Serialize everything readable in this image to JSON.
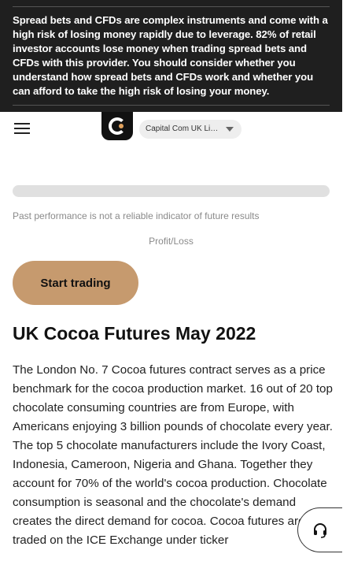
{
  "risk_warning": {
    "text_start": "Spread bets and CFDs are complex instruments and come with a high risk of losing money rapidly due to leverage. ",
    "text_bold": "82% of retail investor accounts lose money when trading spread bets and CFDs with this provider",
    "text_end": ". You should consider whether you understand how spread bets and CFDs work and whether you can afford to take the high risk of losing your money."
  },
  "header": {
    "entity_selector": "Capital Com UK Limited",
    "logo_letter": "C"
  },
  "disclaimer": "Past performance is not a reliable indicator of future results",
  "profit_loss_label": "Profit/Loss",
  "cta_label": "Start trading",
  "article": {
    "title": "UK Cocoa Futures May 2022",
    "body": "The London No. 7 Cocoa futures contract serves as a price benchmark for the cocoa production market. 16 out of 20 top chocolate consuming countries are from Europe, with Americans enjoying 3 billion pounds of chocolate every year. The top 5 chocolate manufacturers include the Ivory Coast, Indonesia, Cameroon, Nigeria and Ghana. Together they account for 70% of the world's cocoa production. Chocolate consumption is seasonal and the chocolate's demand creates the direct demand for cocoa. Cocoa futures are traded on the ICE Exchange under ticker"
  },
  "colors": {
    "accent": "#c69a6e",
    "banner": "#1f1f1f",
    "logo_dot": "#e0a15d"
  },
  "icons": {
    "menu": "hamburger-icon",
    "support": "headset-icon"
  }
}
